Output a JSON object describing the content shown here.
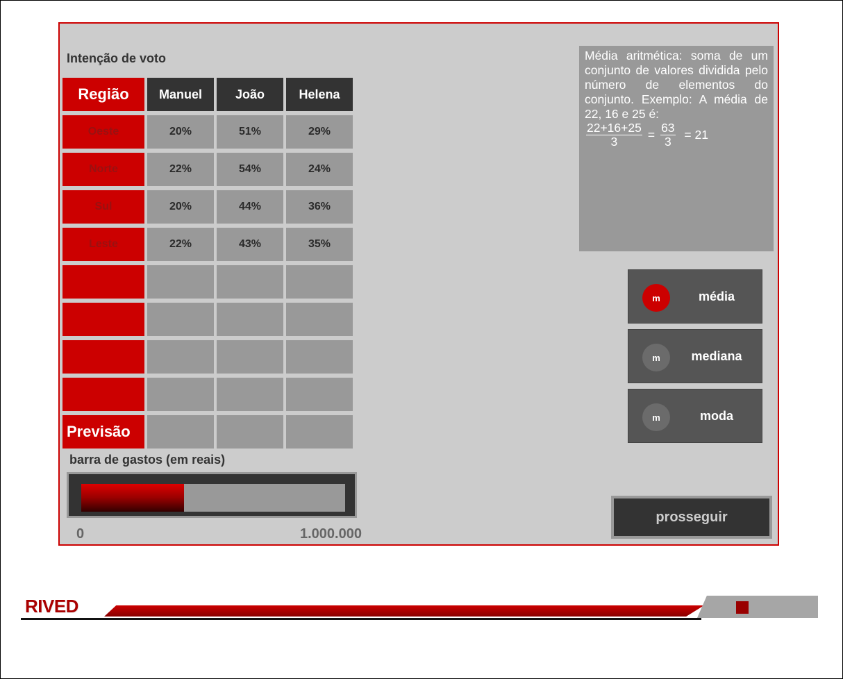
{
  "table": {
    "title": "Intenção de voto",
    "header_region": "Região",
    "candidates": [
      "Manuel",
      "João",
      "Helena"
    ],
    "rows": [
      {
        "region": "Oeste",
        "values": [
          "20%",
          "51%",
          "29%"
        ]
      },
      {
        "region": "Norte",
        "values": [
          "22%",
          "54%",
          "24%"
        ]
      },
      {
        "region": "Sul",
        "values": [
          "20%",
          "44%",
          "36%"
        ]
      },
      {
        "region": "Leste",
        "values": [
          "22%",
          "43%",
          "35%"
        ]
      }
    ],
    "empty_rows": 4,
    "forecast_label": "Previsão"
  },
  "info": {
    "text": "Média aritmética: soma de um conjunto de valores dividida pelo número de elementos do conjunto. Exemplo: A média de 22, 16 e 25 é:",
    "frac1_num": "22+16+25",
    "frac1_den": "3",
    "equals1": "=",
    "frac2_num": "63",
    "frac2_den": "3",
    "result": "= 21"
  },
  "buttons": [
    {
      "icon_text": "m",
      "label": "média",
      "active": true
    },
    {
      "icon_text": "m",
      "label": "mediana",
      "active": false
    },
    {
      "icon_text": "m",
      "label": "moda",
      "active": false
    }
  ],
  "spending": {
    "title": "barra de gastos (em reais)",
    "min_label": "0",
    "max_label": "1.000.000",
    "fill_fraction": 0.39
  },
  "prosseguir_label": "prosseguir",
  "footer": {
    "logo": "RIVED"
  }
}
